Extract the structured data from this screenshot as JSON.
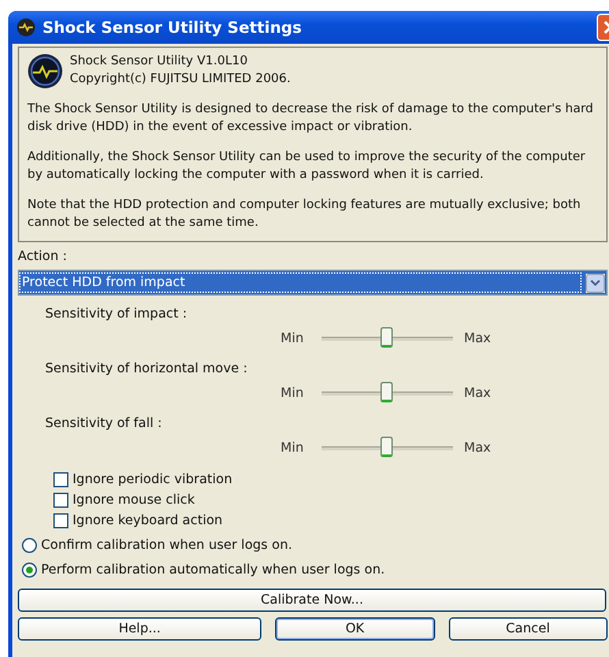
{
  "window": {
    "title": "Shock Sensor Utility Settings"
  },
  "info": {
    "product": "Shock Sensor Utility V1.0L10",
    "copyright": "Copyright(c) FUJITSU LIMITED 2006.",
    "paragraphs": [
      "The Shock Sensor Utility is designed to decrease the risk of damage to the computer's hard disk drive (HDD) in the event of excessive impact or vibration.",
      "Additionally, the Shock Sensor Utility can be used to improve the security of the computer by automatically locking the computer with a password when it is carried.",
      "Note that the HDD protection and computer locking features are mutually exclusive; both cannot be selected at the same time."
    ]
  },
  "action": {
    "label": "Action :",
    "value": "Protect HDD from impact"
  },
  "sliders": [
    {
      "label": "Sensitivity of impact :",
      "min_label": "Min",
      "max_label": "Max",
      "level": 0.5
    },
    {
      "label": "Sensitivity of horizontal move :",
      "min_label": "Min",
      "max_label": "Max",
      "level": 0.5
    },
    {
      "label": "Sensitivity of fall :",
      "min_label": "Min",
      "max_label": "Max",
      "level": 0.5
    }
  ],
  "checkboxes": [
    {
      "label": "Ignore periodic vibration",
      "checked": false
    },
    {
      "label": "Ignore mouse click",
      "checked": false
    },
    {
      "label": "Ignore keyboard action",
      "checked": false
    }
  ],
  "radios": [
    {
      "label": "Confirm calibration when user logs on.",
      "selected": false
    },
    {
      "label": "Perform calibration automatically when user logs on.",
      "selected": true
    }
  ],
  "calibrate_button": "Calibrate Now...",
  "buttons": [
    {
      "label": "Help...",
      "default": false
    },
    {
      "label": "OK",
      "default": true
    },
    {
      "label": "Cancel",
      "default": false
    }
  ]
}
